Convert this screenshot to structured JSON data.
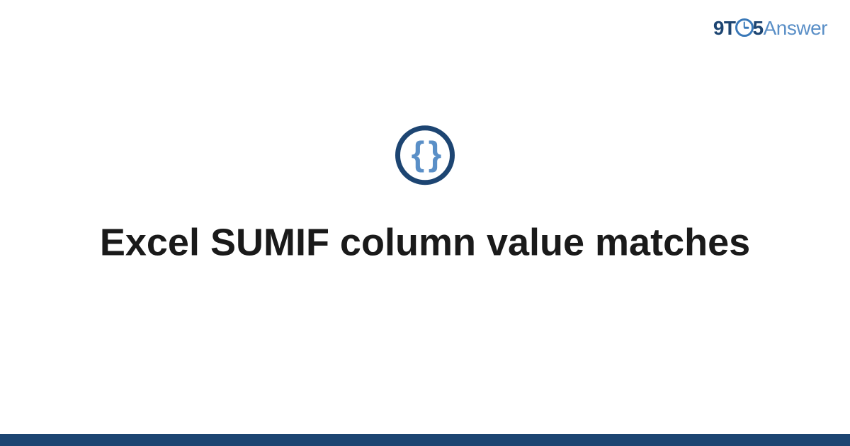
{
  "logo": {
    "part1": "9T",
    "part2": "5",
    "part3": "Answer"
  },
  "icon": {
    "name": "code-braces-icon",
    "glyph": "{ }"
  },
  "title": "Excel SUMIF column value matches",
  "colors": {
    "dark_blue": "#1d4572",
    "light_blue": "#5a8fc7",
    "mid_blue": "#3978b8"
  }
}
